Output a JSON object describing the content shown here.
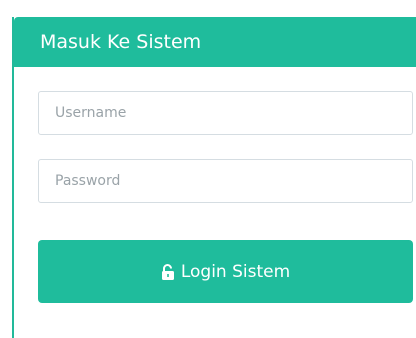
{
  "panel": {
    "title": "Masuk Ke Sistem"
  },
  "form": {
    "username_placeholder": "Username",
    "username_value": "",
    "password_placeholder": "Password",
    "password_value": "",
    "login_label": "Login Sistem",
    "login_icon": "unlock-icon"
  },
  "colors": {
    "accent": "#1fbc9c",
    "input_border": "#d5dde2",
    "placeholder": "#9aa3a8"
  }
}
